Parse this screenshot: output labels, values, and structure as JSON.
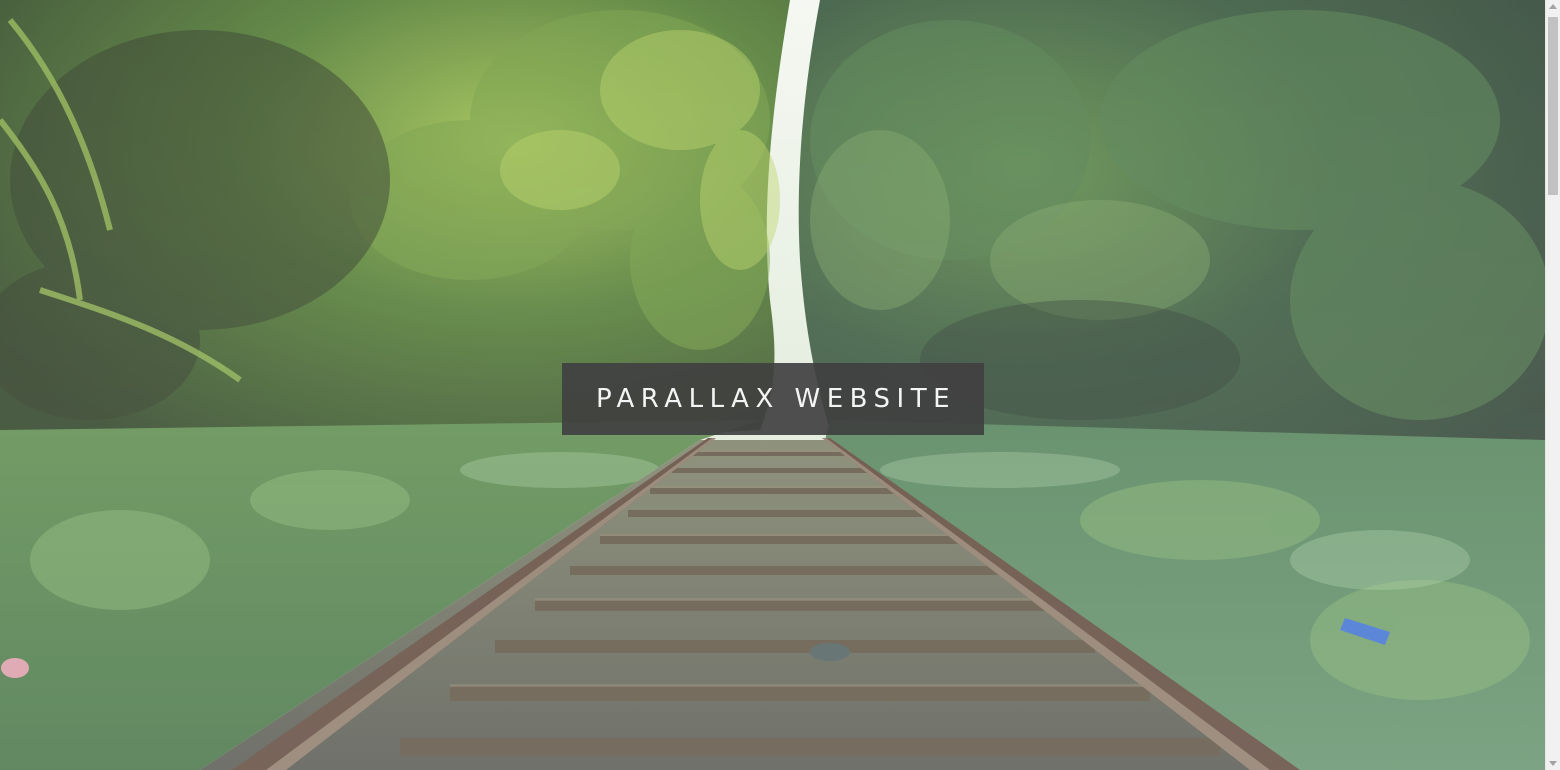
{
  "hero": {
    "title": "PARALLAX WEBSITE",
    "background_image": "railway-tracks-through-forest",
    "overlay_color": "#ffffff"
  },
  "colors": {
    "title_box": "#404040",
    "title_text": "#f4f4f4",
    "scrollbar_track": "#f1f1f1",
    "scrollbar_thumb": "#c1c1c1"
  },
  "scrollbar": {
    "position": 0.0
  }
}
